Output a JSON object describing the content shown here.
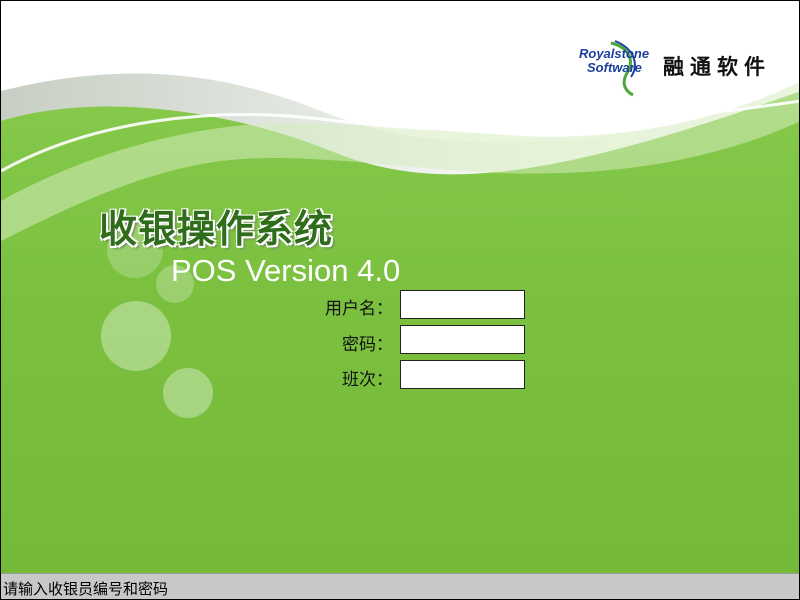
{
  "app": {
    "title": "收银操作系统",
    "version": "POS Version 4.0"
  },
  "brand": {
    "en_line1": "Royalstone",
    "en_line2": "Software",
    "cn": "融通软件"
  },
  "login": {
    "username_label": "用户名：",
    "username_value": "",
    "password_label": "密码：",
    "password_value": "",
    "shift_label": "班次：",
    "shift_value": ""
  },
  "status": {
    "message": "请输入收银员编号和密码"
  },
  "colors": {
    "background_green": "#7cc242",
    "title_green": "#2f6d1b",
    "brand_blue": "#1d3fa0",
    "statusbar": "#c8c8c8"
  }
}
